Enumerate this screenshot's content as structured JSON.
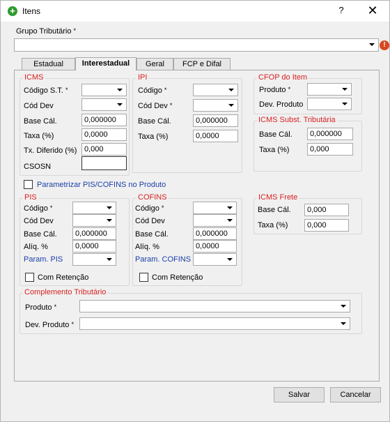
{
  "window": {
    "title": "Itens",
    "help": "?",
    "close": "✕"
  },
  "grupo": {
    "label": "Grupo Tributário",
    "value": ""
  },
  "tabs": [
    "Estadual",
    "Interestadual",
    "Geral",
    "FCP e Difal"
  ],
  "icms": {
    "legend": "ICMS",
    "codigo_st": "Código S.T.",
    "cod_dev": "Cód Dev",
    "base_calc": "Base Cál.",
    "base_calc_value": "0,000000",
    "taxa": "Taxa (%)",
    "taxa_value": "0,0000",
    "tx_diferido": "Tx. Diferido (%)",
    "tx_diferido_value": "0,000",
    "csosn": "CSOSN",
    "csosn_value": ""
  },
  "ipi": {
    "legend": "IPI",
    "codigo": "Código",
    "cod_dev": "Cód Dev",
    "base_calc": "Base Cál.",
    "base_calc_value": "0,000000",
    "taxa": "Taxa (%)",
    "taxa_value": "0,0000"
  },
  "cfop": {
    "legend": "CFOP do Item",
    "produto": "Produto",
    "dev_produto": "Dev. Produto"
  },
  "icms_st": {
    "legend": "ICMS Subst. Tributária",
    "base_calc": "Base Cál.",
    "base_calc_value": "0,000000",
    "taxa": "Taxa (%)",
    "taxa_value": "0,000"
  },
  "parametrizar": {
    "label": "Parametrizar PIS/COFINS no Produto"
  },
  "pis": {
    "legend": "PIS",
    "codigo": "Código",
    "cod_dev": "Cód Dev",
    "base_calc": "Base Cál.",
    "base_calc_value": "0,000000",
    "aliq": "Alíq. %",
    "aliq_value": "0,0000",
    "param": "Param. PIS",
    "retencao": "Com Retenção"
  },
  "cofins": {
    "legend": "COFINS",
    "codigo": "Código",
    "cod_dev": "Cód Dev",
    "base_calc": "Base Cál.",
    "base_calc_value": "0,000000",
    "aliq": "Alíq. %",
    "aliq_value": "0,0000",
    "param": "Param. COFINS",
    "retencao": "Com Retenção"
  },
  "icms_frete": {
    "legend": "ICMS Frete",
    "base_calc": "Base Cál.",
    "base_calc_value": "0,000",
    "taxa": "Taxa (%)",
    "taxa_value": "0,000"
  },
  "complemento": {
    "legend": "Complemento Tributário",
    "produto": "Produto",
    "dev_produto": "Dev. Produto"
  },
  "buttons": {
    "salvar": "Salvar",
    "cancelar": "Cancelar"
  },
  "required_mark": "*",
  "colors": {
    "legend_red": "#d81f1f",
    "legend_blue": "#1a3fa8",
    "title_icon": "#2e9b2e",
    "warning": "#d9481e"
  }
}
